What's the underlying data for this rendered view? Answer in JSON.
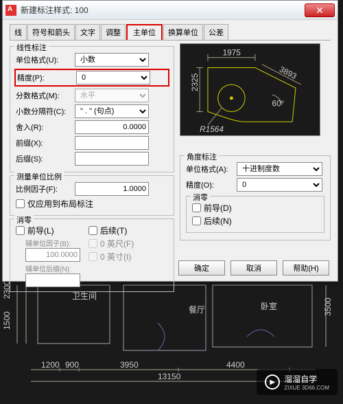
{
  "window": {
    "title": "新建标注样式: 100"
  },
  "tabs": [
    "线",
    "符号和箭头",
    "文字",
    "调整",
    "主单位",
    "换算单位",
    "公差"
  ],
  "active_tab_index": 4,
  "linear": {
    "group_title": "线性标注",
    "unit_format_label": "单位格式(U):",
    "unit_format_value": "小数",
    "precision_label": "精度(P):",
    "precision_value": "0",
    "fraction_label": "分数格式(M):",
    "fraction_value": "水平",
    "decimal_sep_label": "小数分隔符(C):",
    "decimal_sep_value": "\" . \" (句点)",
    "round_label": "舍入(R):",
    "round_value": "0.0000",
    "prefix_label": "前缀(X):",
    "prefix_value": "",
    "suffix_label": "后缀(S):",
    "suffix_value": ""
  },
  "scale": {
    "group_title": "测量单位比例",
    "factor_label": "比例因子(F):",
    "factor_value": "1.0000",
    "layout_only_label": "仅应用到布局标注"
  },
  "zero_suppress": {
    "group_title": "消零",
    "leading_label": "前导(L)",
    "sub_factor_label": "辅单位因子(B):",
    "sub_factor_value": "100.0000",
    "sub_suffix_label": "辅单位后缀(N):",
    "sub_suffix_value": "",
    "trailing_label": "后续(T)",
    "feet_label": "0 英尺(F)",
    "inch_label": "0 英寸(I)"
  },
  "angular": {
    "group_title": "角度标注",
    "unit_format_label": "单位格式(A):",
    "unit_format_value": "十进制度数",
    "precision_label": "精度(O):",
    "precision_value": "0",
    "zero_group": "消零",
    "leading_label": "前导(D)",
    "trailing_label": "后续(N)"
  },
  "preview": {
    "top_dim": "1975",
    "left_dim": "2325",
    "angle": "60°",
    "radius": "R1564",
    "diag": "3893"
  },
  "buttons": {
    "ok": "确定",
    "cancel": "取消",
    "help": "帮助(H)"
  },
  "floorplan": {
    "rooms": [
      "卫生间",
      "餐厅",
      "卧室"
    ],
    "dims": {
      "left_v1": "2300",
      "left_v2": "1500",
      "right_v": "3500",
      "bottom1": "1200",
      "bottom2": "900",
      "bottom3": "3950",
      "bottom4": "4400",
      "bottom_total": "13150"
    }
  },
  "watermark": {
    "text": "溜溜自学",
    "sub": "ZIXUE 3D66.COM"
  }
}
